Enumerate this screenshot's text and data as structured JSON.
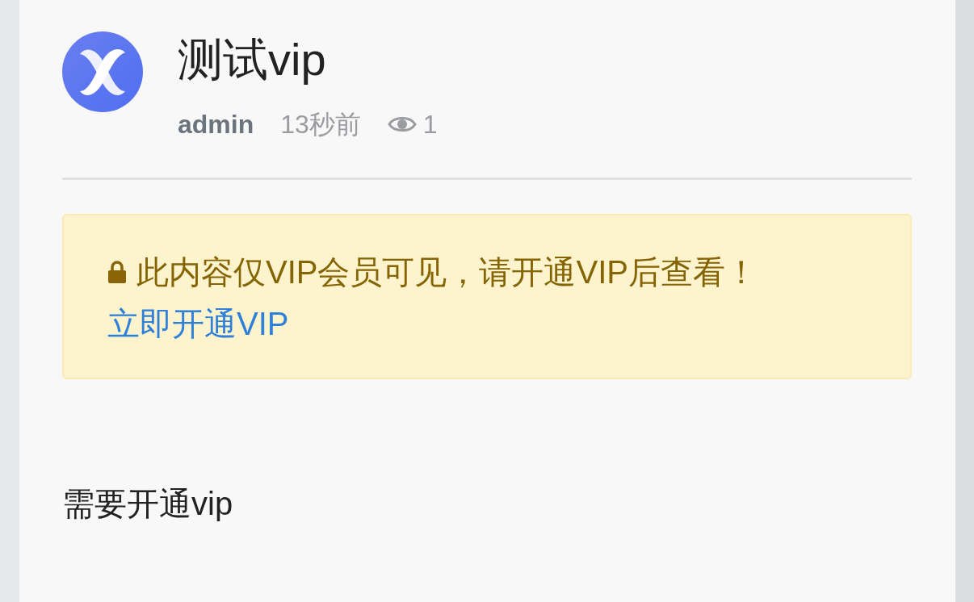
{
  "post": {
    "title": "测试vip",
    "author": "admin",
    "time": "13秒前",
    "views": "1"
  },
  "notice": {
    "message": "此内容仅VIP会员可见，请开通VIP后查看！",
    "link": "立即开通VIP"
  },
  "body": "需要开通vip"
}
